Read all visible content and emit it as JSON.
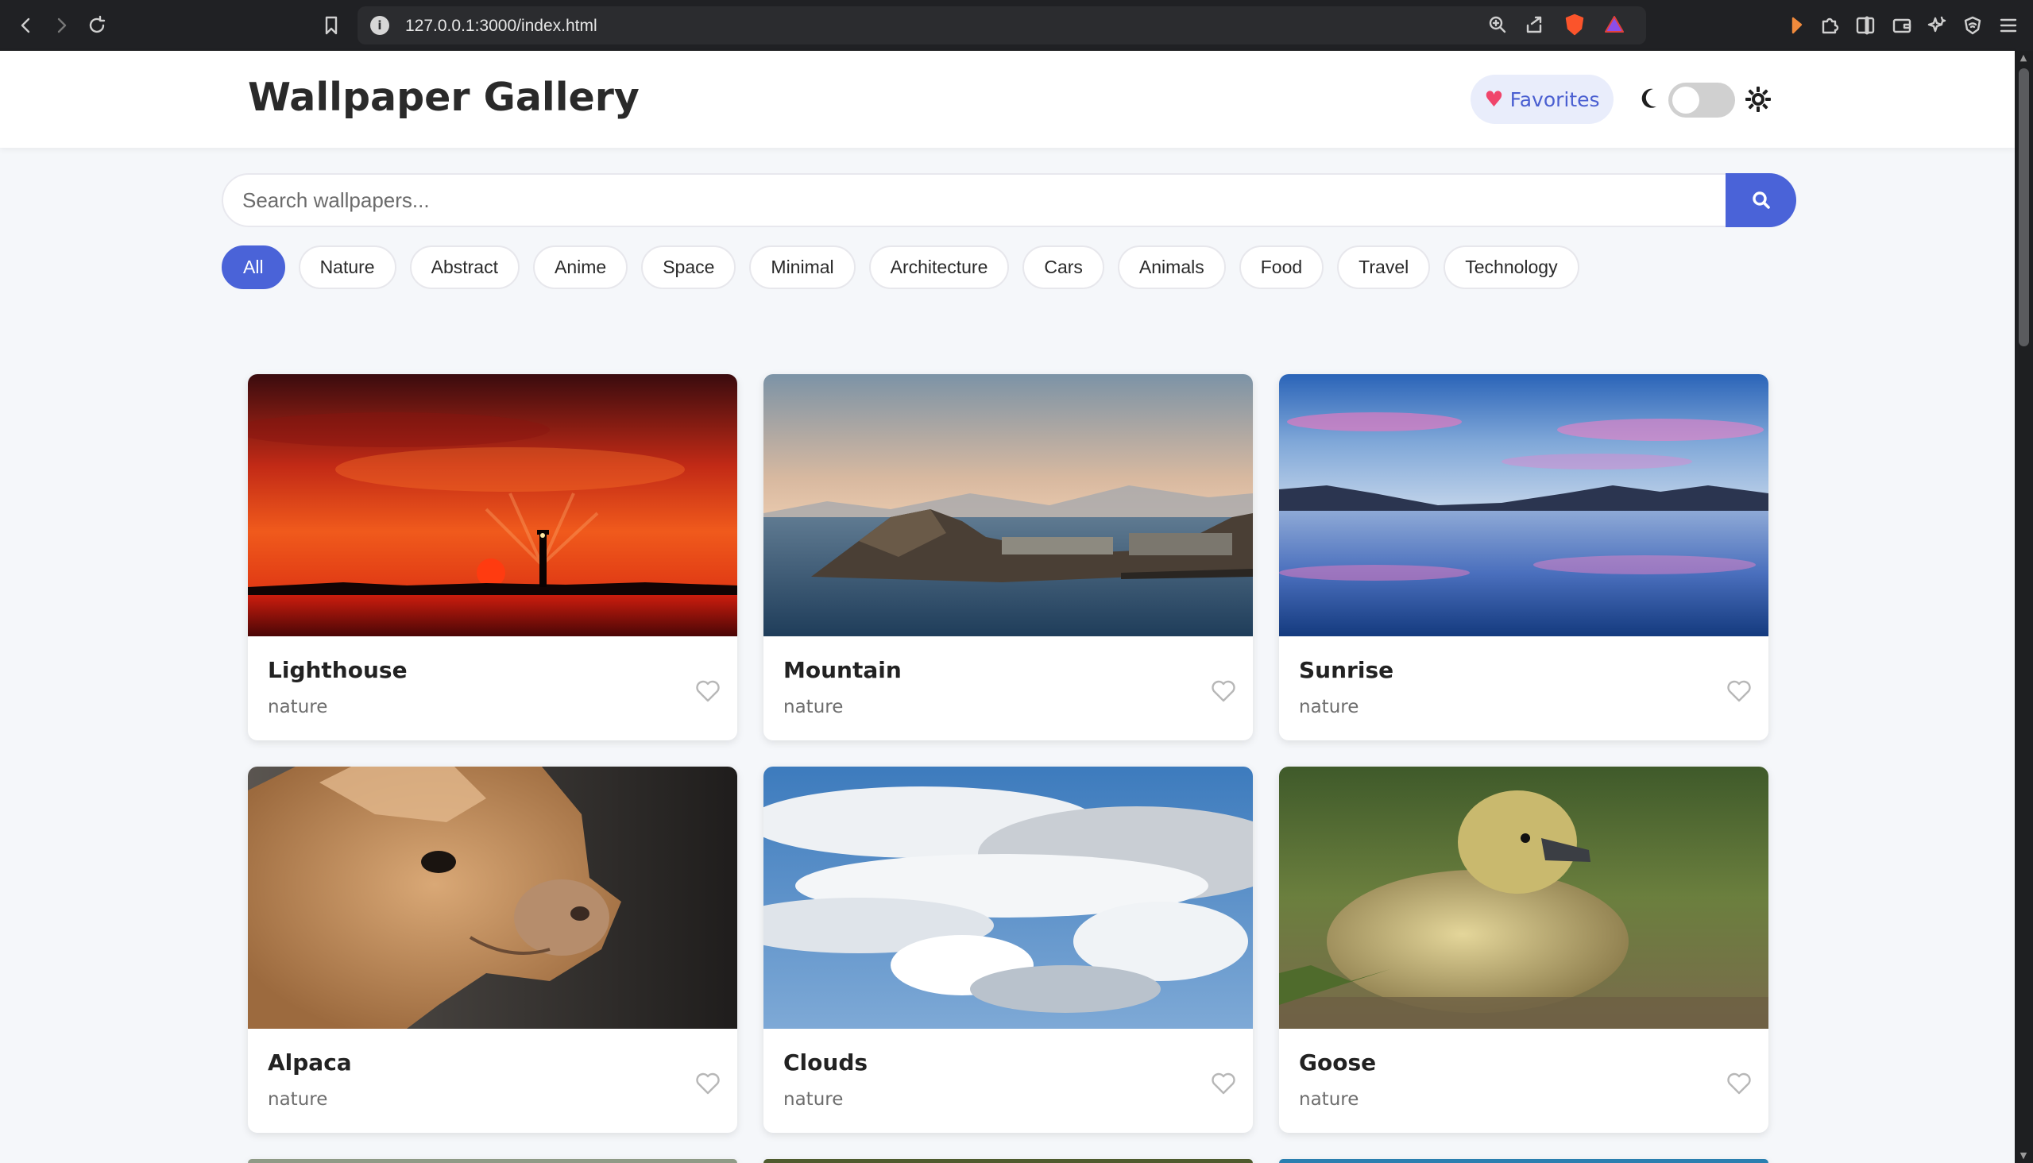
{
  "browser": {
    "url": "127.0.0.1:3000/index.html"
  },
  "header": {
    "title": "Wallpaper Gallery",
    "favorites_label": "Favorites"
  },
  "search": {
    "placeholder": "Search wallpapers..."
  },
  "categories": [
    {
      "label": "All",
      "active": true
    },
    {
      "label": "Nature",
      "active": false
    },
    {
      "label": "Abstract",
      "active": false
    },
    {
      "label": "Anime",
      "active": false
    },
    {
      "label": "Space",
      "active": false
    },
    {
      "label": "Minimal",
      "active": false
    },
    {
      "label": "Architecture",
      "active": false
    },
    {
      "label": "Cars",
      "active": false
    },
    {
      "label": "Animals",
      "active": false
    },
    {
      "label": "Food",
      "active": false
    },
    {
      "label": "Travel",
      "active": false
    },
    {
      "label": "Technology",
      "active": false
    }
  ],
  "wallpapers": [
    {
      "title": "Lighthouse",
      "category": "nature"
    },
    {
      "title": "Mountain",
      "category": "nature"
    },
    {
      "title": "Sunrise",
      "category": "nature"
    },
    {
      "title": "Alpaca",
      "category": "nature"
    },
    {
      "title": "Clouds",
      "category": "nature"
    },
    {
      "title": "Goose",
      "category": "nature"
    }
  ],
  "colors": {
    "accent": "#4a63d8",
    "heart": "#f0456b",
    "chrome": "#202124"
  },
  "theme": {
    "dark_mode": false
  }
}
